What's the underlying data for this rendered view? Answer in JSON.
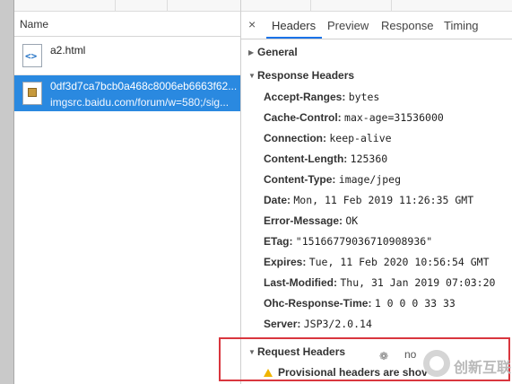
{
  "requests": {
    "column_header": "Name",
    "items": [
      {
        "icon": "html-file-icon",
        "name": "a2.html",
        "url": ""
      },
      {
        "icon": "image-file-icon",
        "name": "0df3d7ca7bcb0a468c8006eb6663f62...",
        "url": "imgsrc.baidu.com/forum/w=580;/sig..."
      }
    ]
  },
  "tabs": {
    "close": "×",
    "items": [
      "Headers",
      "Preview",
      "Response",
      "Timing"
    ],
    "active": "Headers"
  },
  "sections": {
    "general": "General",
    "response_headers": "Response Headers",
    "request_headers": "Request Headers"
  },
  "response_headers": [
    {
      "key": "Accept-Ranges:",
      "value": "bytes"
    },
    {
      "key": "Cache-Control:",
      "value": "max-age=31536000"
    },
    {
      "key": "Connection:",
      "value": "keep-alive"
    },
    {
      "key": "Content-Length:",
      "value": "125360"
    },
    {
      "key": "Content-Type:",
      "value": "image/jpeg"
    },
    {
      "key": "Date:",
      "value": "Mon, 11 Feb 2019 11:26:35 GMT"
    },
    {
      "key": "Error-Message:",
      "value": "OK"
    },
    {
      "key": "ETag:",
      "value": "\"15166779036710908936\""
    },
    {
      "key": "Expires:",
      "value": "Tue, 11 Feb 2020 10:56:54 GMT"
    },
    {
      "key": "Last-Modified:",
      "value": "Thu, 31 Jan 2019 07:03:20"
    },
    {
      "key": "Ohc-Response-Time:",
      "value": "1 0 0 0 33 33"
    },
    {
      "key": "Server:",
      "value": "JSP3/2.0.14"
    }
  ],
  "request_warning": "Provisional headers are shov",
  "watermark": {
    "small_text": "no",
    "brand": "创新互联"
  },
  "colors": {
    "selected_row": "#2a89e0",
    "tab_underline": "#1a73e8",
    "highlight_box": "#d9363e",
    "warning": "#f0b400"
  }
}
